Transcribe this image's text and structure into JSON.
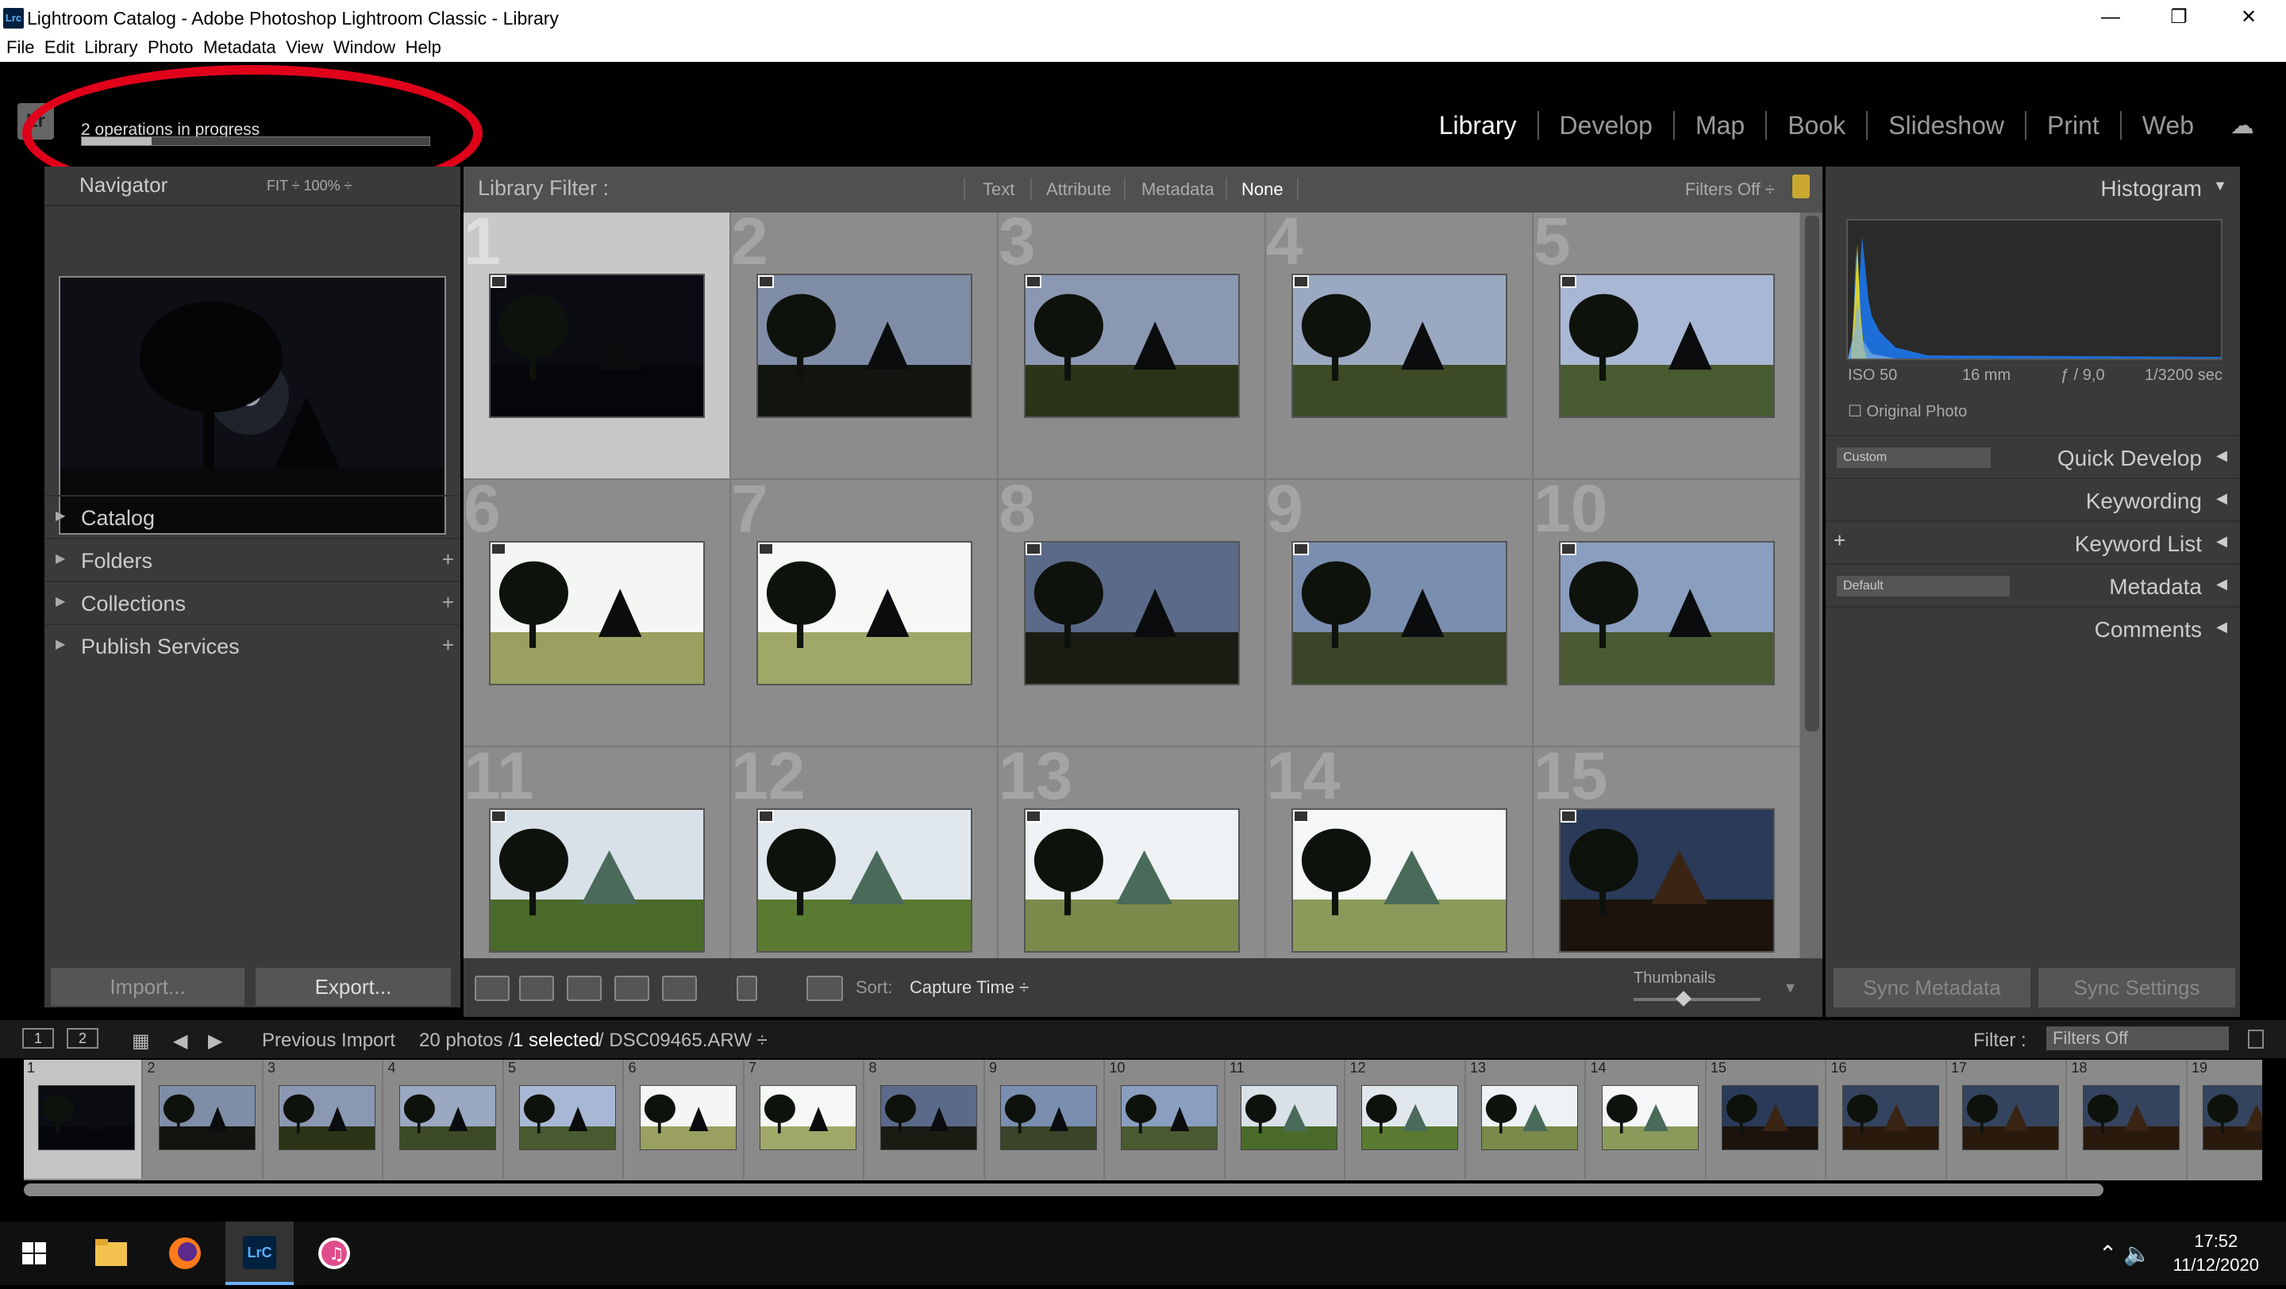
{
  "window": {
    "app_icon": "Lrc",
    "title": "Lightroom Catalog - Adobe Photoshop Lightroom Classic - Library",
    "minimize": "—",
    "restore": "❐",
    "close": "✕"
  },
  "menu": [
    "File",
    "Edit",
    "Library",
    "Photo",
    "Metadata",
    "View",
    "Window",
    "Help"
  ],
  "progress": {
    "text": "2 operations in progress",
    "fraction": 0.2
  },
  "logo": "Lr",
  "modules": [
    "Library",
    "Develop",
    "Map",
    "Book",
    "Slideshow",
    "Print",
    "Web"
  ],
  "navigator": {
    "title": "Navigator",
    "fit": "FIT ÷   100% ÷"
  },
  "left_sections": [
    {
      "label": "Catalog",
      "plus": ""
    },
    {
      "label": "Folders",
      "plus": "+"
    },
    {
      "label": "Collections",
      "plus": "+"
    },
    {
      "label": "Publish Services",
      "plus": "+"
    }
  ],
  "left_buttons": {
    "import": "Import...",
    "export": "Export..."
  },
  "filter_bar": {
    "label": "Library Filter :",
    "options": [
      "Text",
      "Attribute",
      "Metadata",
      "None"
    ],
    "filters_off": "Filters Off ÷"
  },
  "grid_numbers": [
    "1",
    "2",
    "3",
    "4",
    "5",
    "6",
    "7",
    "8",
    "9",
    "10",
    "11",
    "12",
    "13",
    "14",
    "15"
  ],
  "toolbar": {
    "sort_label": "Sort:",
    "sort_value": "Capture Time ÷",
    "thumbnails_label": "Thumbnails"
  },
  "right_panel": {
    "histogram_title": "Histogram",
    "iso": "ISO 50",
    "focal": "16 mm",
    "aperture": "ƒ / 9,0",
    "shutter": "1/3200 sec",
    "original_photo": "Original Photo",
    "sections": [
      {
        "label": "Quick Develop",
        "dropdown": "Custom"
      },
      {
        "label": "Keywording",
        "dropdown": ""
      },
      {
        "label": "Keyword List",
        "dropdown": "+"
      },
      {
        "label": "Metadata",
        "dropdown": "Default"
      },
      {
        "label": "Comments",
        "dropdown": ""
      }
    ],
    "sync_metadata": "Sync Metadata",
    "sync_settings": "Sync Settings"
  },
  "filmstrip_header": {
    "view1": "1",
    "view2": "2",
    "source": "Previous Import",
    "count": "20 photos /",
    "selected": "1 selected",
    "file": "/ DSC09465.ARW ÷",
    "filter_label": "Filter :",
    "filter_value": "Filters Off"
  },
  "filmstrip_numbers": [
    "1",
    "2",
    "3",
    "4",
    "5",
    "6",
    "7",
    "8",
    "9",
    "10",
    "11",
    "12",
    "13",
    "14",
    "15",
    "16",
    "17",
    "18",
    "19"
  ],
  "taskbar": {
    "time": "17:52",
    "date": "11/12/2020",
    "lrc_label": "LrC"
  },
  "icons": {
    "windows": "windows-start-icon",
    "explorer": "folder-icon",
    "firefox": "firefox-icon",
    "lrc": "lightroom-icon",
    "itunes": "itunes-icon",
    "cloud": "cloud-icon"
  },
  "colors": {
    "annotation": "#e0001a",
    "background": "#000000",
    "panel": "#3a3a3a",
    "grid": "#8c8c8c"
  }
}
